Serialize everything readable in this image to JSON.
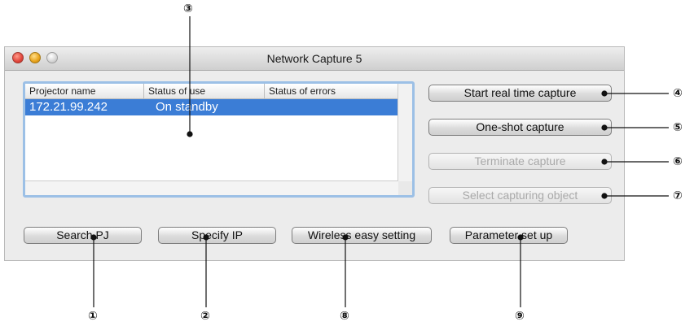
{
  "window": {
    "title": "Network Capture 5"
  },
  "table": {
    "columns": [
      "Projector name",
      "Status of use",
      "Status of errors"
    ],
    "rows": [
      {
        "projector_name": "172.21.99.242",
        "status_of_use": "On standby",
        "status_of_errors": ""
      }
    ]
  },
  "buttons": {
    "start_realtime": "Start real time capture",
    "one_shot": "One-shot capture",
    "terminate": "Terminate capture",
    "select_object": "Select capturing object",
    "search_pj": "Search PJ",
    "specify_ip": "Specify IP",
    "wireless": "Wireless easy setting",
    "parameter": "Parameter set up"
  },
  "callouts": {
    "c1": "①",
    "c2": "②",
    "c3": "③",
    "c4": "④",
    "c5": "⑤",
    "c6": "⑥",
    "c7": "⑦",
    "c8": "⑧",
    "c9": "⑨"
  }
}
